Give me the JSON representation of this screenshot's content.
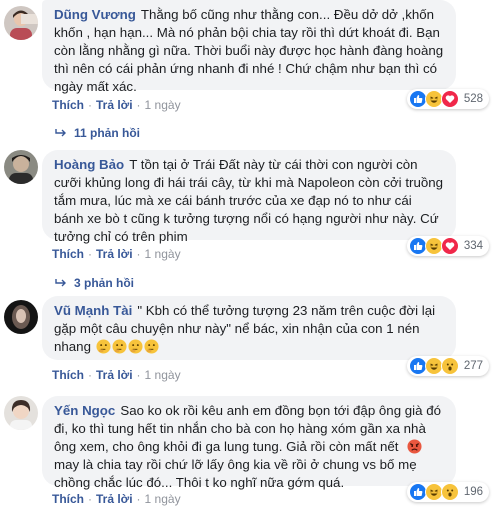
{
  "comments": [
    {
      "author": "Dũng Vương",
      "text": "Thằng bố cũng như thằng con... Đều dở dở ,khốn khốn , hạn hạn... Mà nó phản bội chia tay rồi thì dứt khoát đi. Bạn còn lằng nhằng gì nữa. Thời buổi này được học hành đàng hoàng thì nên có cái phản ứng nhanh đi nhé ! Chứ chậm như bạn thì có ngày mất xác.",
      "reaction_count": "528",
      "reactions": [
        "like",
        "haha",
        "love"
      ],
      "like_label": "Thích",
      "reply_label": "Trả lời",
      "time": "1 ngày",
      "replies_label": "11 phản hồi"
    },
    {
      "author": "Hoàng Bảo",
      "text": "T tồn tại ở Trái Đất này từ cái thời con người còn cưỡi khủng long đi hái trái cây, từ khi mà Napoleon còn cởi truồng tắm mưa, lúc mà xe cái bánh trước của xe đạp nó to như cái bánh xe bò t cũng k tưởng tượng nổi có hạng người như này. Cứ tưởng chỉ có trên phim",
      "reaction_count": "334",
      "reactions": [
        "like",
        "haha",
        "love"
      ],
      "like_label": "Thích",
      "reply_label": "Trả lời",
      "time": "1 ngày",
      "replies_label": "3 phản hồi"
    },
    {
      "author": "Vũ Mạnh Tài",
      "text": "\" Kbh có thể tưởng tượng 23 năm trên cuộc đời lại gặp một câu chuyện như này\" nể bác, xin nhận của con 1 nén nhang",
      "reaction_count": "277",
      "reactions": [
        "like",
        "haha",
        "wow"
      ],
      "like_label": "Thích",
      "reply_label": "Trả lời",
      "time": "1 ngày"
    },
    {
      "author": "Yến Ngọc",
      "text_part1": "Sao ko ok rồi kêu anh em đồng bọn tới đập ông già đó đi, ko thì tung hết tin nhắn cho bà con họ hàng xóm gần xa nhà ông xem, cho ông khỏi đi ga lung tung. Giả rồi còn mất nết",
      "text_part2": "may là chia tay rồi chứ lỡ lấy ông kia về rồi ở chung vs bố mẹ chồng chắc lúc đó... Thôi t ko nghĩ nữa gớm quá.",
      "reaction_count": "196",
      "reactions": [
        "like",
        "haha",
        "wow"
      ],
      "like_label": "Thích",
      "reply_label": "Trả lời",
      "time": "1 ngày"
    }
  ],
  "colors": {
    "name": "#385898",
    "bubble": "#f2f3f5",
    "meta": "#90949c",
    "like": "#1877f2",
    "love": "#f0284a",
    "haha": "#f7c33b"
  }
}
